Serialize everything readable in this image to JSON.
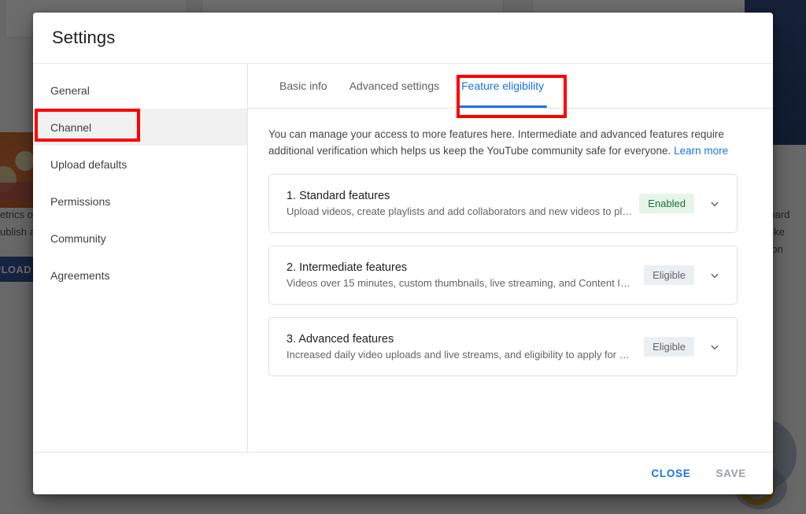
{
  "background": {
    "left_text_lines": [
      "etrics o",
      "ublish a"
    ],
    "upload_button_label": "PLOAD",
    "right_text_lines": [
      "forward",
      "es like",
      "ize on"
    ]
  },
  "modal": {
    "title": "Settings",
    "sidebar": {
      "items": [
        {
          "label": "General",
          "selected": false
        },
        {
          "label": "Channel",
          "selected": true
        },
        {
          "label": "Upload defaults",
          "selected": false
        },
        {
          "label": "Permissions",
          "selected": false
        },
        {
          "label": "Community",
          "selected": false
        },
        {
          "label": "Agreements",
          "selected": false
        }
      ]
    },
    "tabs": [
      {
        "label": "Basic info",
        "active": false
      },
      {
        "label": "Advanced settings",
        "active": false
      },
      {
        "label": "Feature eligibility",
        "active": true
      }
    ],
    "panel": {
      "description_text": "You can manage your access to more features here. Intermediate and advanced features require additional verification which helps us keep the YouTube community safe for everyone.",
      "learn_more_label": "Learn more",
      "features": [
        {
          "title": "1. Standard features",
          "subtitle": "Upload videos, create playlists and add collaborators and new videos to play…",
          "status": "Enabled",
          "status_style": "enabled",
          "chevron_icon": "chevron-down-icon"
        },
        {
          "title": "2. Intermediate features",
          "subtitle": "Videos over 15 minutes, custom thumbnails, live streaming, and Content ID a…",
          "status": "Eligible",
          "status_style": "eligible",
          "chevron_icon": "chevron-down-icon"
        },
        {
          "title": "3. Advanced features",
          "subtitle": "Increased daily video uploads and live streams, and eligibility to apply for mo…",
          "status": "Eligible",
          "status_style": "eligible",
          "chevron_icon": "chevron-down-icon"
        }
      ]
    },
    "footer": {
      "close_label": "CLOSE",
      "save_label": "SAVE"
    }
  },
  "annotations": {
    "highlight_color": "#ff0000",
    "boxes": [
      {
        "target": "sidebar-item-channel"
      },
      {
        "target": "tab-feature-eligibility"
      }
    ]
  },
  "colors": {
    "accent_blue": "#1a73e8",
    "enabled_bg": "#e6f4ea",
    "enabled_fg": "#137333",
    "eligible_bg": "#eceff1",
    "eligible_fg": "#5f6368",
    "annotation_red": "#ff0000"
  }
}
